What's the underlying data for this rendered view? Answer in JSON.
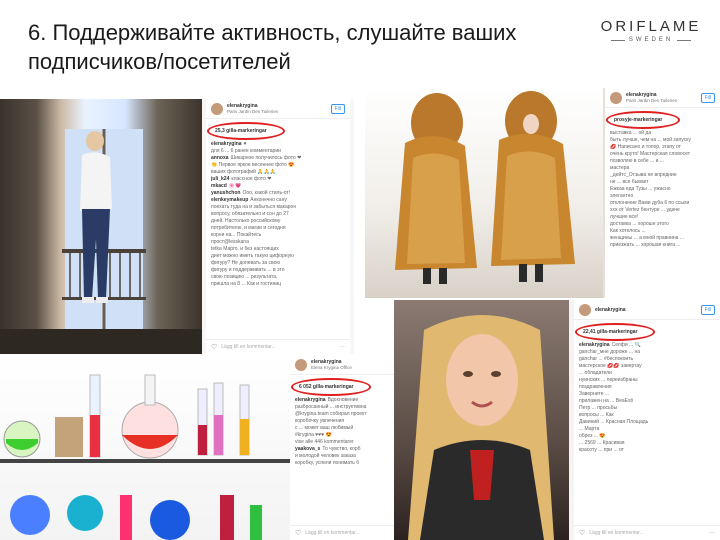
{
  "slide": {
    "title": "6. Поддерживайте активность, слушайте ваших подписчиков/посетителей",
    "brand": {
      "name": "ORIFLAME",
      "sub": "SWEDEN"
    }
  },
  "posts": [
    {
      "user": "elenakrygina",
      "place": "Paris Jardin Des Tuileries",
      "follow": "Fill",
      "likes": "25,3 gilla-markeringar",
      "comments": [
        {
          "u": "elenakrygina",
          "t": "♥"
        },
        {
          "u": "",
          "t": "для 6 ... 6 ранее комментарии"
        },
        {
          "u": "annoxa",
          "t": "Шикарное получилось фото ❤"
        },
        {
          "u": "",
          "t": "👏 Первое яркое весеннее фото 😍"
        },
        {
          "u": "",
          "t": "ваших фотографий 🙏🙏🙏"
        },
        {
          "u": "juli_k24",
          "t": "классное фото ❤"
        },
        {
          "u": "mkacd",
          "t": "🌸💗"
        },
        {
          "u": "yanushchon",
          "t": "Ооо, какой стиль-от!"
        },
        {
          "u": "elenkeymakeup",
          "t": "Анконечно сану"
        },
        {
          "u": "",
          "t": "поехать туда на и забыться макарон"
        },
        {
          "u": "",
          "t": "вопросу, обязательно и сон до 27"
        },
        {
          "u": "",
          "t": "дней. Настолько российскому"
        },
        {
          "u": "",
          "t": "потребителю, и магии и сегодня"
        },
        {
          "u": "",
          "t": "корни на... Покайтесь"
        },
        {
          "u": "",
          "t": "прост@lesskana"
        },
        {
          "u": "",
          "t": "tetka Марго. и без настоящих"
        },
        {
          "u": "",
          "t": "диет можно иметь такую цифорную"
        },
        {
          "u": "",
          "t": "фигуру? Не допевать за свою"
        },
        {
          "u": "",
          "t": "фигуру и поддерживать ... в это"
        },
        {
          "u": "",
          "t": "свою позицию ... результата,"
        },
        {
          "u": "",
          "t": "пришла на 8 ... Как и гостиниц"
        }
      ],
      "add_comment": "Lägg till en kommentar..."
    },
    {
      "user": "elenakrygina",
      "place": "Paris Jardin Des Tuileries",
      "follow": "Fill",
      "likes": "prosyje-markeringar",
      "comments": [
        {
          "u": "",
          "t": "выставка ... ой да"
        },
        {
          "u": "",
          "t": "быть лучше, чем на ... мой запуску"
        },
        {
          "u": "",
          "t": "💋 Написано и топор, этапу от"
        },
        {
          "u": "",
          "t": "очень круто! Мастерская словосет"
        },
        {
          "u": "",
          "t": "позволяю в себе ... и ..."
        },
        {
          "u": "",
          "t": "мастера"
        },
        {
          "u": "",
          "t": "_дейтс_Отзыва не впредние"
        },
        {
          "u": "",
          "t": "не ... все бывает"
        },
        {
          "u": "",
          "t": "Ежкаа еда Тузы ... ужасно"
        },
        {
          "u": "",
          "t": "элегантно"
        },
        {
          "u": "",
          "t": "отклонение Вами дуба 6 по ссыхи"
        },
        {
          "u": "",
          "t": "ххх от Vertez бентуре ... удаче"
        },
        {
          "u": "",
          "t": "лучшие все!"
        },
        {
          "u": "",
          "t": "доставка ... хороше этого"
        },
        {
          "u": "",
          "t": "Как хотелось ..."
        },
        {
          "u": "",
          "t": "женщины ... а мной правнина ..."
        },
        {
          "u": "",
          "t": "приезжать ... хорошая книга ..."
        }
      ],
      "add_comment": "Lägg till en kommentar..."
    },
    {
      "user": "elenakrygina",
      "place": "Elena Krygina Office",
      "follow": "Fill",
      "likes": "6 052 gilla-markeringar",
      "comments": [
        {
          "u": "elenakrygina",
          "t": "Вдохновение"
        },
        {
          "u": "",
          "t": "разбросанный ... инструктивна"
        },
        {
          "u": "",
          "t": "@krygina.team собирал проект"
        },
        {
          "u": "",
          "t": "коробочку увлечения"
        },
        {
          "u": "",
          "t": "с ... может ваш любимый"
        },
        {
          "u": "",
          "t": "#krygina ♥♥♥ 😍"
        },
        {
          "u": "",
          "t": "vise alle 446 kommentarer"
        },
        {
          "u": "yaakova_s",
          "t": "То чувство, корб"
        },
        {
          "u": "",
          "t": "и молодой человек заказа"
        },
        {
          "u": "",
          "t": "коробку, успели понимать б"
        }
      ],
      "add_comment": "Lägg till en kommentar..."
    },
    {
      "user": "elenakrygina",
      "place": "",
      "follow": "Fill",
      "likes": "22,41 gilla-markeringar",
      "comments": [
        {
          "u": "elenakrygina",
          "t": "Селфи ... 🔍"
        },
        {
          "u": "",
          "t": "ganchar_мне дороже ... на"
        },
        {
          "u": "",
          "t": "ganchar ... #беспокоить"
        },
        {
          "u": "",
          "t": "мастерское 💋💋 завертау"
        },
        {
          "u": "",
          "t": "... обладатели"
        },
        {
          "u": "",
          "t": "нуинских ... переизбраны"
        },
        {
          "u": "",
          "t": "поздравления"
        },
        {
          "u": "",
          "t": "Заверните ..."
        },
        {
          "u": "",
          "t": "прилажен на ... BeaEsti"
        },
        {
          "u": "",
          "t": "Петр ... просьбы"
        },
        {
          "u": "",
          "t": "вопросы ... Как"
        },
        {
          "u": "",
          "t": "Давиний ... Красная Площадь"
        },
        {
          "u": "",
          "t": "... Марта"
        },
        {
          "u": "",
          "t": "обрез ... 😍"
        },
        {
          "u": "",
          "t": "... 2569 ... Красивая"
        },
        {
          "u": "",
          "t": "красоту ... при ... от"
        }
      ],
      "add_comment": "Lägg till en kommentar..."
    }
  ],
  "colors": {
    "highlight_ring": "#e02020",
    "link_blue": "#3897f0"
  },
  "icons": [
    "heart-icon",
    "more-options-icon"
  ]
}
